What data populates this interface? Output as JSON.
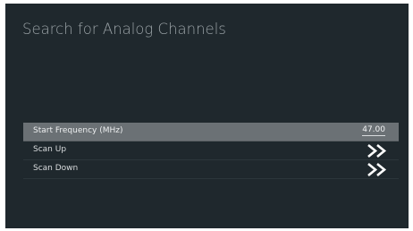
{
  "screen": {
    "title": "Search for Analog Channels"
  },
  "menu": {
    "items": [
      {
        "label": "Start Frequency (MHz)",
        "value": "47.00"
      },
      {
        "label": "Scan Up",
        "icon": "double-chevron-right-icon"
      },
      {
        "label": "Scan Down",
        "icon": "double-chevron-right-icon"
      }
    ]
  },
  "colors": {
    "background": "#1f282d",
    "selected_row": "#6b7175",
    "title_text": "#9ba3a7",
    "item_text": "#d9dcde",
    "chevron": "#ffffff"
  }
}
